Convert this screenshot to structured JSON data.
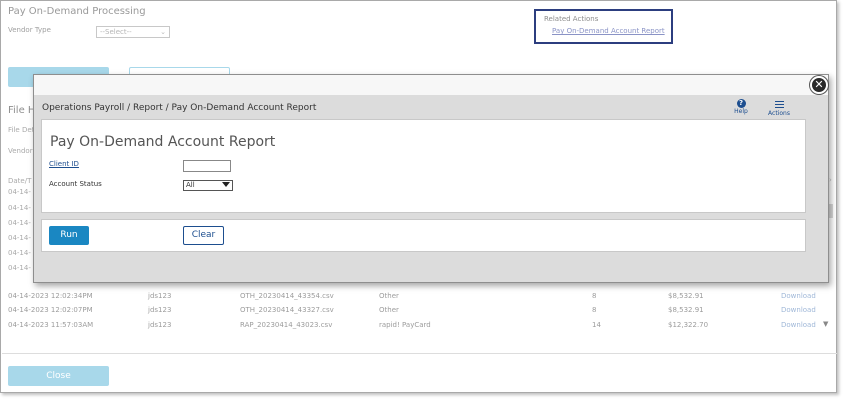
{
  "background": {
    "title": "Pay On-Demand Processing",
    "vendor_type_label": "Vendor Type",
    "vendor_type_value": "--Select--",
    "related_actions": {
      "title": "Related Actions",
      "link": "Pay On-Demand Account Report"
    },
    "primary_button": "",
    "secondary_button": "",
    "file_history_title": "File Hi",
    "file_detail_label": "File Det",
    "vendor_label": "Vendor",
    "date_column_header": "Date/T",
    "left_dates": [
      "04-14-",
      "04-14-",
      "04-14-",
      "04-14-",
      "04-14-",
      "04-14-"
    ],
    "rows": [
      {
        "date": "04-14-2023 12:02:34PM",
        "user": "jds123",
        "file": "OTH_20230414_43354.csv",
        "type": "Other",
        "count": "8",
        "amount": "$8,532.91",
        "action": "Download"
      },
      {
        "date": "04-14-2023 12:02:07PM",
        "user": "jds123",
        "file": "OTH_20230414_43327.csv",
        "type": "Other",
        "count": "8",
        "amount": "$8,532.91",
        "action": "Download"
      },
      {
        "date": "04-14-2023 11:57:03AM",
        "user": "jds123",
        "file": "RAP_20230414_43023.csv",
        "type": "rapid! PayCard",
        "count": "14",
        "amount": "$12,322.70",
        "action": "Download"
      }
    ],
    "close_button": "Close"
  },
  "modal": {
    "breadcrumb": "Operations Payroll / Report / Pay On-Demand Account Report",
    "help_label": "Help",
    "actions_label": "Actions",
    "close_symbol": "✕",
    "report_title": "Pay On-Demand Account Report",
    "client_id_label": "Client ID",
    "client_id_value": "",
    "account_status_label": "Account Status",
    "account_status_value": "All",
    "run_button": "Run",
    "clear_button": "Clear"
  },
  "colors": {
    "accent": "#1a87c2",
    "link": "#1d4e8f",
    "related_border": "#2c3e7f"
  },
  "icons": {
    "help": "help-circle-icon",
    "actions": "hamburger-menu-icon",
    "close": "close-circle-icon"
  }
}
